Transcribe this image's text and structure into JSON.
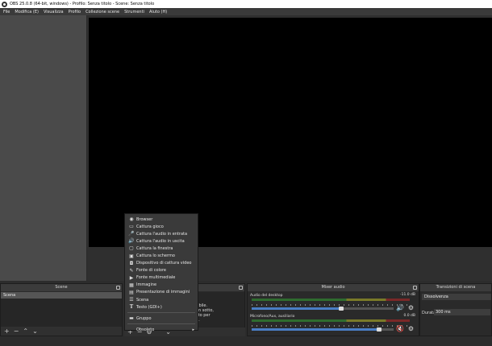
{
  "window": {
    "title": "OBS 25.0.8 (64-bit, windows) - Profilo: Senza titolo - Scene: Senza titolo"
  },
  "menu": [
    "File",
    "Modifica (E)",
    "Visualizza",
    "Profilo",
    "Collezione scene",
    "Strumenti",
    "Aiuto (H)"
  ],
  "docks": {
    "scenes": {
      "title": "Scene",
      "items": [
        "Scena"
      ]
    },
    "sources": {
      "hint_lines": "ribile.\n in sotto,\nsto per\ne."
    },
    "mixer": {
      "title": "Mixer audio",
      "tracks": [
        {
          "name": "Audio del desktop",
          "db": "-11.0 dB",
          "volume": 0.63,
          "muted": false
        },
        {
          "name": "Microfono/Aux, ausiliario",
          "db": "0.0 dB",
          "volume": 0.9,
          "muted": true
        }
      ]
    },
    "transitions": {
      "title": "Transizioni di scena",
      "selected": "Dissolvenza",
      "duration_label": "Durata",
      "duration_value": "300 ms"
    }
  },
  "context_menu": {
    "items": [
      {
        "label": "Browser",
        "icon": "globe-icon"
      },
      {
        "label": "Cattura gioco",
        "icon": "gamepad-icon"
      },
      {
        "label": "Cattura l'audio in entrata",
        "icon": "microphone-icon"
      },
      {
        "label": "Cattura l'audio in uscita",
        "icon": "speaker-icon"
      },
      {
        "label": "Cattura la finestra",
        "icon": "window-icon"
      },
      {
        "label": "Cattura lo schermo",
        "icon": "monitor-icon"
      },
      {
        "label": "Dispositivo di cattura video",
        "icon": "camera-icon"
      },
      {
        "label": "Fonte di colore",
        "icon": "brush-icon"
      },
      {
        "label": "Fonte multimediale",
        "icon": "play-icon"
      },
      {
        "label": "Immagine",
        "icon": "image-icon"
      },
      {
        "label": "Presentazione di immagini",
        "icon": "slideshow-icon"
      },
      {
        "label": "Scena",
        "icon": "list-icon"
      },
      {
        "label": "Testo (GDI+)",
        "icon": "text-icon"
      },
      {
        "label": "Gruppo",
        "icon": "folder-icon"
      },
      {
        "label": "Obsoleto",
        "icon": ""
      }
    ]
  },
  "colors": {
    "preview": "#000000",
    "meter_blue": "#4a7ec4",
    "mute_red": "#e23b3b"
  }
}
